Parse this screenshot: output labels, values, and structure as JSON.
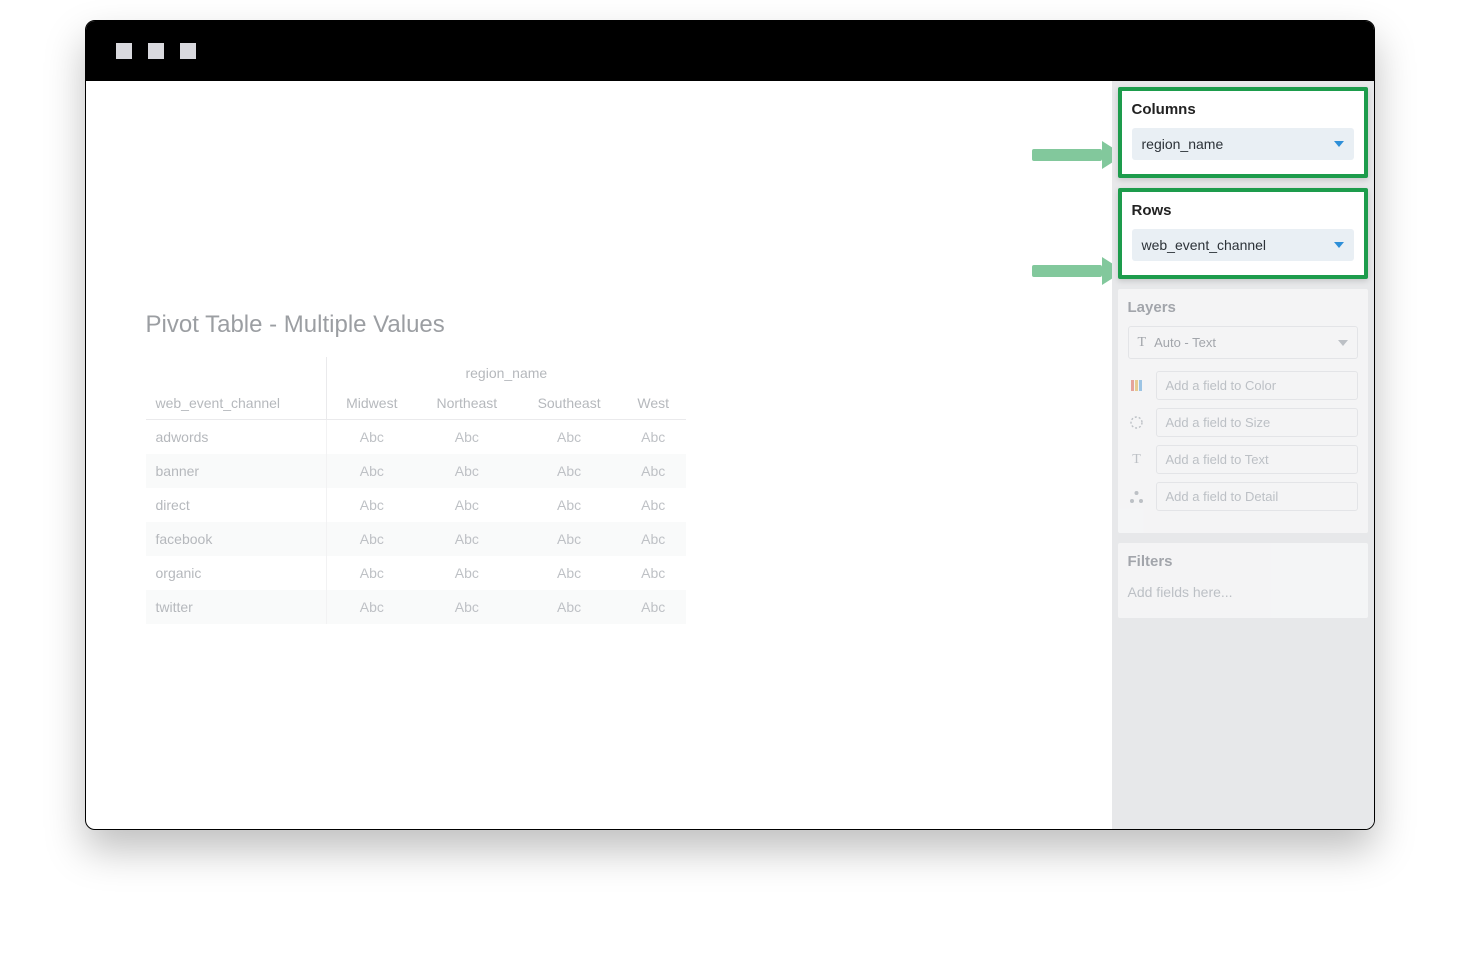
{
  "chart": {
    "title": "Pivot Table - Multiple Values",
    "column_field_label": "region_name",
    "row_field_label": "web_event_channel",
    "columns": [
      "Midwest",
      "Northeast",
      "Southeast",
      "West"
    ],
    "rows": [
      "adwords",
      "banner",
      "direct",
      "facebook",
      "organic",
      "twitter"
    ],
    "cell_placeholder": "Abc"
  },
  "sidebar": {
    "columns": {
      "title": "Columns",
      "field": "region_name"
    },
    "rows": {
      "title": "Rows",
      "field": "web_event_channel"
    },
    "layers": {
      "title": "Layers",
      "mode": "Auto - Text",
      "slots": {
        "color": "Add a field to Color",
        "size": "Add a field to Size",
        "text": "Add a field to Text",
        "detail": "Add a field to Detail"
      }
    },
    "filters": {
      "title": "Filters",
      "placeholder": "Add fields here..."
    }
  },
  "chart_data": {
    "type": "table",
    "title": "Pivot Table - Multiple Values",
    "column_dimension": "region_name",
    "row_dimension": "web_event_channel",
    "columns": [
      "Midwest",
      "Northeast",
      "Southeast",
      "West"
    ],
    "rows": [
      "adwords",
      "banner",
      "direct",
      "facebook",
      "organic",
      "twitter"
    ],
    "values": [
      [
        "Abc",
        "Abc",
        "Abc",
        "Abc"
      ],
      [
        "Abc",
        "Abc",
        "Abc",
        "Abc"
      ],
      [
        "Abc",
        "Abc",
        "Abc",
        "Abc"
      ],
      [
        "Abc",
        "Abc",
        "Abc",
        "Abc"
      ],
      [
        "Abc",
        "Abc",
        "Abc",
        "Abc"
      ],
      [
        "Abc",
        "Abc",
        "Abc",
        "Abc"
      ]
    ]
  }
}
